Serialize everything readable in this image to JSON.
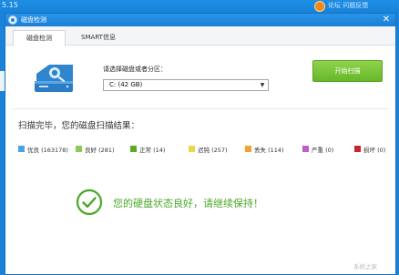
{
  "background_app": {
    "version": "5.15",
    "links": "论坛  问题反馈"
  },
  "window": {
    "title": "磁盘检测",
    "close_glyph": "✕"
  },
  "tabs": [
    {
      "label": "磁盘检测",
      "active": true
    },
    {
      "label": "SMART信息",
      "active": false
    }
  ],
  "disk_selector": {
    "label": "请选择磁盘或者分区：",
    "value": "C:  (42 GB)"
  },
  "scan_button": {
    "label": "开始扫描"
  },
  "results": {
    "heading": "扫描完毕，您的磁盘扫描结果：",
    "legend": [
      {
        "label": "优良 (163178)",
        "color": "#4aa3e0"
      },
      {
        "label": "良好 (281)",
        "color": "#8ccc55"
      },
      {
        "label": "正常 (14)",
        "color": "#5aaa24"
      },
      {
        "label": "迟钝 (257)",
        "color": "#f2d44a"
      },
      {
        "label": "丢失 (114)",
        "color": "#f0a433"
      },
      {
        "label": "严重 (0)",
        "color": "#c25bc7"
      },
      {
        "label": "损坏 (0)",
        "color": "#c4282a"
      }
    ]
  },
  "status": {
    "message": "您的硬盘状态良好，请继续保持！",
    "color": "#4aa82a"
  },
  "watermark": "系统之家"
}
